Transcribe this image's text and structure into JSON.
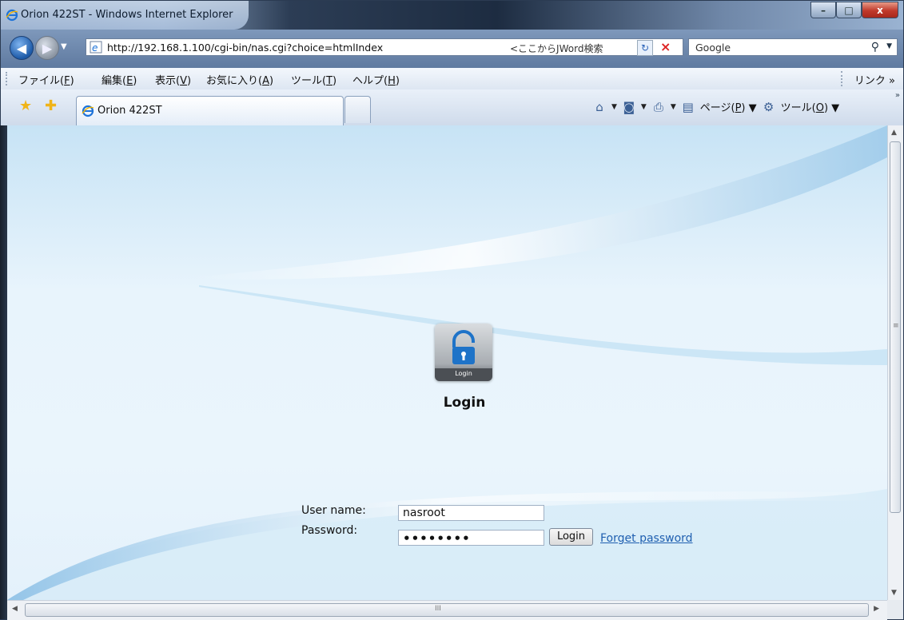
{
  "window": {
    "title": "Orion 422ST - Windows Internet Explorer",
    "minimize": "–",
    "maximize": "□",
    "close": "x"
  },
  "address": {
    "url": "http://192.168.1.100/cgi-bin/nas.cgi?choice=htmlIndex",
    "jword_label": "<ここからJWord検索",
    "search_placeholder": "Google"
  },
  "menu": {
    "items": [
      {
        "label": "ファイル(",
        "key": "F",
        "end": ")"
      },
      {
        "label": "編集(",
        "key": "E",
        "end": ")"
      },
      {
        "label": "表示(",
        "key": "V",
        "end": ")"
      },
      {
        "label": "お気に入り(",
        "key": "A",
        "end": ")"
      },
      {
        "label": "ツール(",
        "key": "T",
        "end": ")"
      },
      {
        "label": "ヘルプ(",
        "key": "H",
        "end": ")"
      }
    ],
    "links": "リンク"
  },
  "tabs": {
    "active_label": "Orion 422ST"
  },
  "command_bar": {
    "page_label": "ページ(",
    "page_key": "P",
    "tools_label": "ツール(",
    "tools_key": "O"
  },
  "login": {
    "icon_caption": "Login",
    "heading": "Login",
    "username_label": "User name:",
    "username_value": "nasroot",
    "password_label": "Password:",
    "password_value": "••••••••",
    "button": "Login",
    "forget_link": "Forget password"
  },
  "scrollbar": {
    "h_grip": "III",
    "v_grip": "≡"
  }
}
